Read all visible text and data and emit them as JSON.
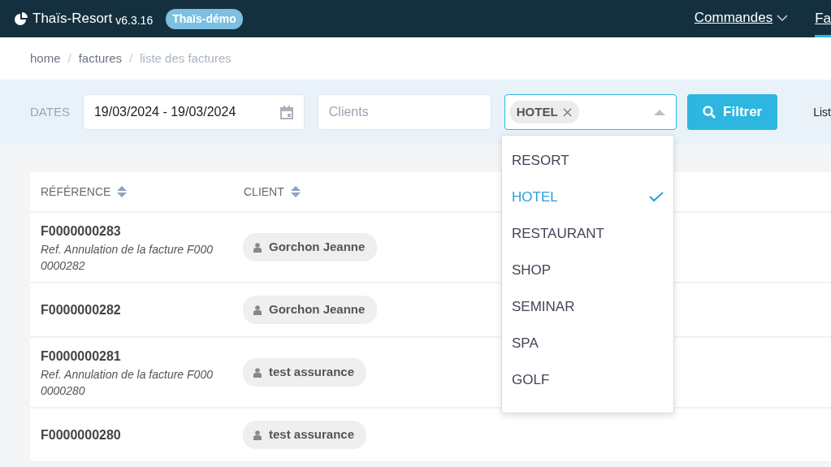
{
  "navbar": {
    "brand": "Thaïs-Resort",
    "version": "v6.3.16",
    "badge": "Thaïs-démo",
    "menu": [
      {
        "label": "Commandes",
        "dropdown": true,
        "selected": false
      },
      {
        "label": "Fa",
        "dropdown": false,
        "selected": true
      }
    ]
  },
  "breadcrumb": [
    {
      "kind": "link",
      "label": "home"
    },
    {
      "kind": "separator",
      "label": "/"
    },
    {
      "kind": "link",
      "label": "factures"
    },
    {
      "kind": "separator",
      "label": "/"
    },
    {
      "kind": "current",
      "label": "liste des factures"
    }
  ],
  "filters": {
    "dates_label": "DATES",
    "date_range": "19/03/2024 - 19/03/2024",
    "clients_placeholder": "Clients",
    "tags": [
      "HOTEL"
    ],
    "filter_button": "Filtrer",
    "column_4": "List"
  },
  "dropdown": {
    "expanded": true,
    "options": [
      {
        "label": "RESORT",
        "selected": false
      },
      {
        "label": "HOTEL",
        "selected": true
      },
      {
        "label": "RESTAURANT",
        "selected": false
      },
      {
        "label": "SHOP",
        "selected": false
      },
      {
        "label": "SEMINAR",
        "selected": false
      },
      {
        "label": "SPA",
        "selected": false
      },
      {
        "label": "GOLF",
        "selected": false
      }
    ]
  },
  "table": {
    "columns": [
      "RÉFÉRENCE",
      "CLIENT"
    ],
    "rows": [
      {
        "reference": "F0000000283",
        "note": "Ref. Annulation de la facture F0000000282",
        "client": "Gorchon Jeanne"
      },
      {
        "reference": "F0000000282",
        "client": "Gorchon Jeanne"
      },
      {
        "reference": "F0000000281",
        "note": "Ref. Annulation de la facture F0000000280",
        "client": "test assurance"
      },
      {
        "reference": "F0000000280",
        "client": "test assurance"
      }
    ]
  }
}
